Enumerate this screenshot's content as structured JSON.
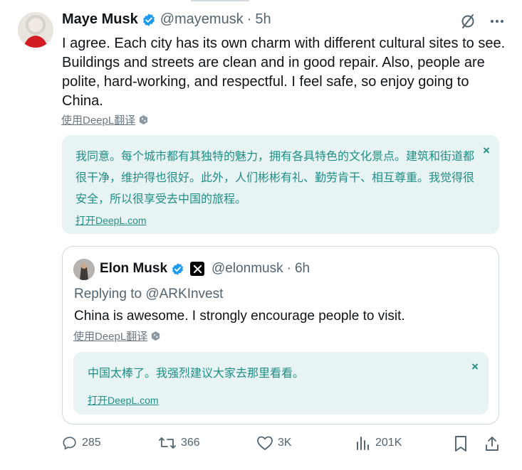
{
  "tweet": {
    "author_name": "Maye Musk",
    "handle": "@mayemusk",
    "time_sep": "·",
    "time": "5h",
    "text": "I agree. Each city has its own charm with different cultural sites to see. Buildings and streets are clean and in good repair. Also, people are polite, hard-working, and respectful. I feel safe, so enjoy going to China.",
    "translate_label": "使用DeepL翻译",
    "translation": {
      "text": "我同意。每个城市都有其独特的魅力，拥有各具特色的文化景点。建筑和街道都很干净，维护得也很好。此外，人们彬彬有礼、勤劳肯干、相互尊重。我觉得很安全，所以很享受去中国的旅程。",
      "open_link": "打开DeepL.com",
      "close": "×"
    }
  },
  "quoted": {
    "author_name": "Elon Musk",
    "handle": "@elonmusk",
    "time_sep": "·",
    "time": "6h",
    "replying_prefix": "Replying to",
    "replying_to": "@ARKInvest",
    "text": "China is awesome. I strongly encourage people to visit.",
    "translate_label": "使用DeepL翻译",
    "translation": {
      "text": "中国太棒了。我强烈建议大家去那里看看。",
      "open_link": "打开DeepL.com",
      "close": "×"
    }
  },
  "actions": {
    "replies": "285",
    "reposts": "366",
    "likes": "3K",
    "views": "201K"
  },
  "colors": {
    "verified_blue": "#1d9bf0",
    "deepl_teal": "#1f8f86",
    "deepl_bg": "#e8f3f3",
    "muted": "#536471"
  },
  "icons": [
    "verified-icon",
    "grok-slash-icon",
    "more-icon",
    "deepl-icon",
    "x-logo-icon",
    "reply-icon",
    "repost-icon",
    "like-icon",
    "views-icon",
    "bookmark-icon",
    "share-icon"
  ]
}
